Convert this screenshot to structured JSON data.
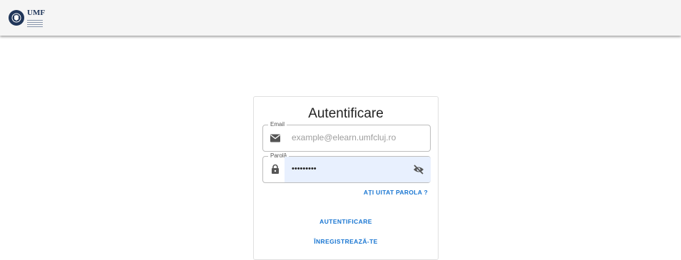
{
  "header": {
    "logo_text": "UMF"
  },
  "login": {
    "title": "Autentificare",
    "email_label": "Email",
    "email_placeholder": "example@elearn.umfcluj.ro",
    "password_label": "Parolă",
    "password_value": "•••••••••",
    "forgot_password": "AȚI UITAT PAROLA ?",
    "login_button": "AUTENTIFICARE",
    "register_button": "ÎNREGISTREAZĂ-TE"
  },
  "icons": {
    "email": "envelope-icon",
    "password": "lock-icon",
    "toggle_visibility": "eye-off-icon"
  },
  "colors": {
    "accent": "#1976d2",
    "logo": "#1f3559",
    "autofill": "#e8f0fe"
  }
}
